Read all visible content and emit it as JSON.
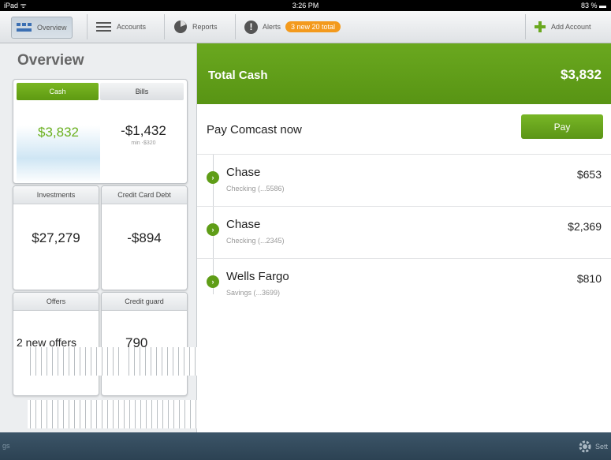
{
  "status_bar": {
    "left": "iPad ᯤ",
    "time": "3:26 PM",
    "battery": "83 % ▬"
  },
  "toolbar": {
    "overview": "Overview",
    "accounts": "Accounts",
    "reports": "Reports",
    "alerts": "Alerts",
    "alerts_badge": "3 new 20 total",
    "add_account": "Add Account"
  },
  "overview": {
    "title": "Overview",
    "tabs": [
      "Cash",
      "Bills"
    ],
    "cash_value": "$3,832",
    "bills_value": "-$1,432",
    "bills_min": "min -$320",
    "cells": [
      {
        "label": "Investments",
        "value": "$27,279"
      },
      {
        "label": "Credit Card Debt",
        "value": "-$894"
      },
      {
        "label": "Offers",
        "value": "2 new offers"
      },
      {
        "label": "Credit guard",
        "value": "790"
      }
    ]
  },
  "main": {
    "total_label": "Total Cash",
    "total_value": "$3,832",
    "pay_text": "Pay Comcast now",
    "pay_button": "Pay",
    "accounts": [
      {
        "name": "Chase",
        "sub": "Checking (...5586)",
        "amount": "$653"
      },
      {
        "name": "Chase",
        "sub": "Checking (...2345)",
        "amount": "$2,369"
      },
      {
        "name": "Wells Fargo",
        "sub": "Savings (...3699)",
        "amount": "$810"
      }
    ]
  },
  "bottom_bar": {
    "left_text": "gs",
    "settings": "Sett"
  },
  "colors": {
    "accent_green": "#5f9d17",
    "badge_orange": "#f39a1d",
    "bottom_bar": "#2f4556"
  }
}
